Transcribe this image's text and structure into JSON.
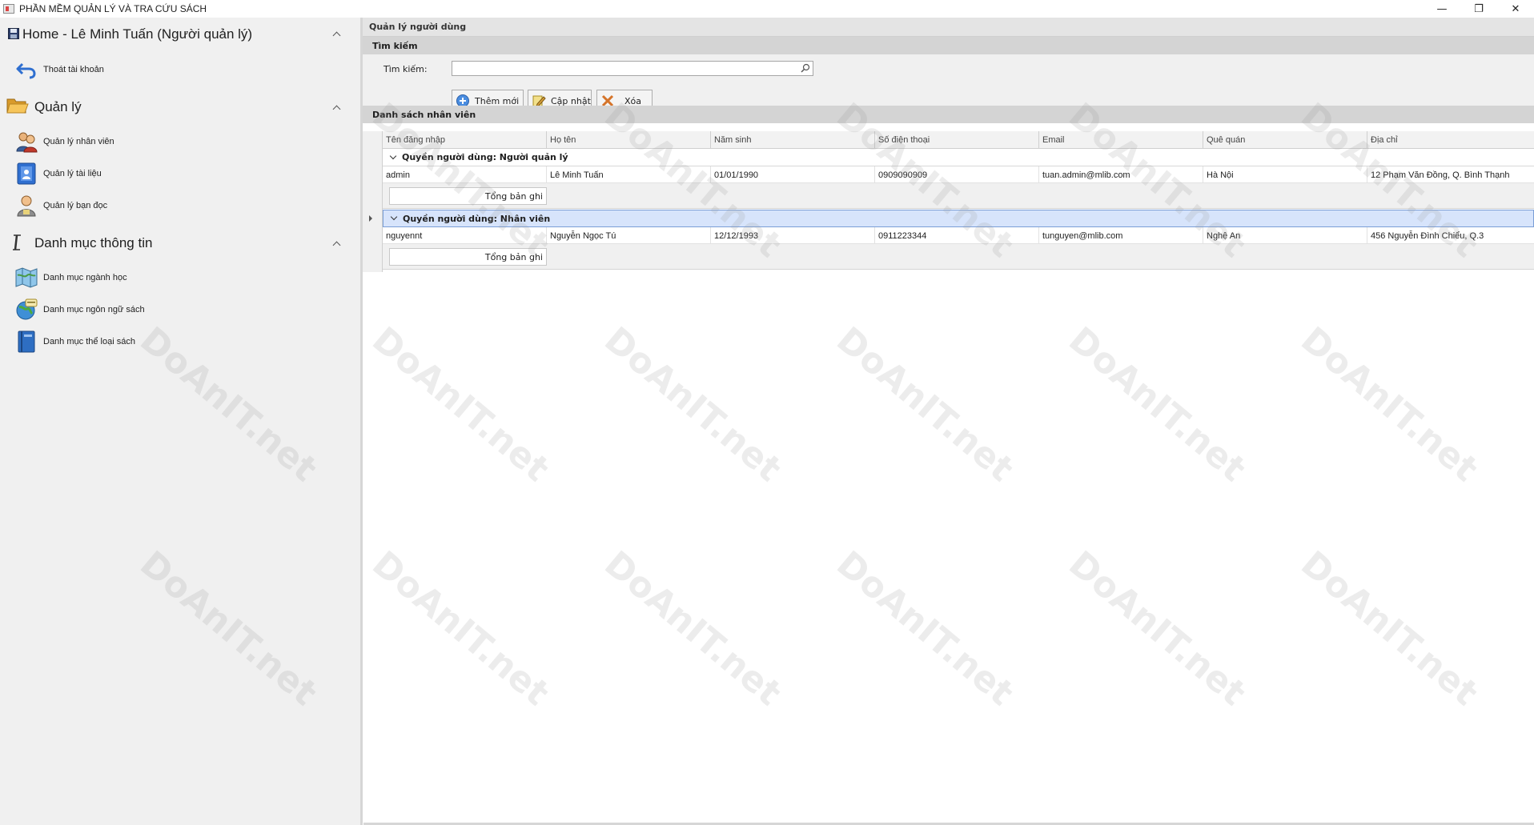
{
  "window": {
    "title": "PHẦN MỀM QUẢN LÝ VÀ TRA CỨU SÁCH",
    "minimize": "—",
    "restore": "❐",
    "close": "✕"
  },
  "nav": {
    "home": {
      "title": "Home - Lê Minh Tuấn (Người quản lý)",
      "items": [
        {
          "label": "Thoát tài khoản",
          "icon": "logout-arrow-icon"
        }
      ]
    },
    "manage": {
      "title": "Quản lý",
      "items": [
        {
          "label": "Quản lý nhân viên",
          "icon": "users-icon"
        },
        {
          "label": "Quản lý tài liệu",
          "icon": "document-icon"
        },
        {
          "label": "Quản lý bạn đọc",
          "icon": "reader-icon"
        }
      ]
    },
    "catalog": {
      "title": "Danh mục thông tin",
      "items": [
        {
          "label": "Danh mục ngành học",
          "icon": "map-icon"
        },
        {
          "label": "Danh mục ngôn ngữ sách",
          "icon": "globe-icon"
        },
        {
          "label": "Danh mục thể loại sách",
          "icon": "book-icon"
        }
      ]
    }
  },
  "main": {
    "title": "Quản lý người dùng",
    "search_section": "Tìm kiếm",
    "search_label": "Tìm kiếm:",
    "search_value": "",
    "buttons": {
      "add": "Thêm mới",
      "update": "Cập nhật",
      "delete": "Xóa"
    },
    "list_section": "Danh sách nhân viên",
    "columns": [
      "Tên đăng nhập",
      "Họ tên",
      "Năm sinh",
      "Số điện thoại",
      "Email",
      "Quê quán",
      "Địa chỉ"
    ],
    "groups": [
      {
        "label": "Quyền người dùng: Người quản lý",
        "rows": [
          [
            "admin",
            "Lê Minh Tuấn",
            "01/01/1990",
            "0909090909",
            "tuan.admin@mlib.com",
            "Hà Nội",
            "12 Phạm Văn Đồng, Q. Bình Thạnh"
          ]
        ],
        "footer": "Tổng bản ghi"
      },
      {
        "label": "Quyền người dùng: Nhân viên",
        "rows": [
          [
            "nguyennt",
            "Nguyễn Ngọc Tú",
            "12/12/1993",
            "0911223344",
            "tunguyen@mlib.com",
            "Nghệ An",
            "456 Nguyễn Đình Chiểu, Q.3"
          ]
        ],
        "footer": "Tổng bản ghi"
      }
    ]
  },
  "watermark": "DoAnIT.net",
  "colors": {
    "selected_group_bg": "#d7e4fb",
    "panel_bg": "#f0f0f0",
    "header_bg": "#d4d4d4"
  }
}
